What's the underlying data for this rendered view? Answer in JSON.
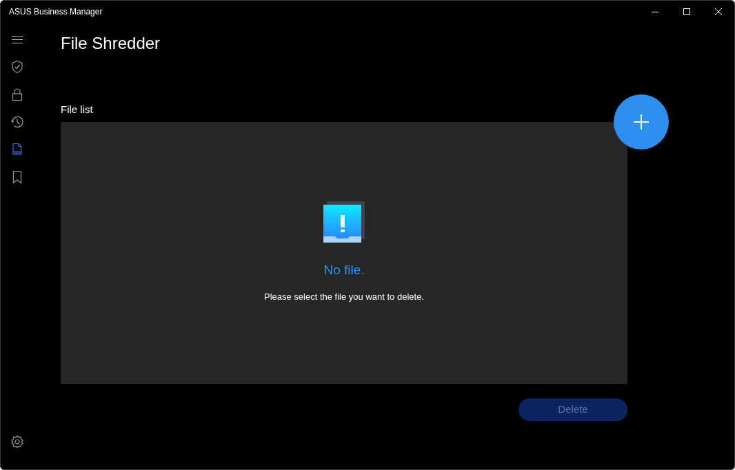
{
  "window": {
    "title": "ASUS Business Manager"
  },
  "sidebar": {
    "items": [
      {
        "kind": "shield",
        "selected": false
      },
      {
        "kind": "lock",
        "selected": false
      },
      {
        "kind": "history",
        "selected": false
      },
      {
        "kind": "shredder",
        "selected": true
      },
      {
        "kind": "bookmark",
        "selected": false
      }
    ]
  },
  "page": {
    "title": "File Shredder",
    "section_label": "File list",
    "empty_title": "No file.",
    "empty_message": "Please select the file you want to delete."
  },
  "delete_button": {
    "label": "Delete",
    "disabled": true
  }
}
